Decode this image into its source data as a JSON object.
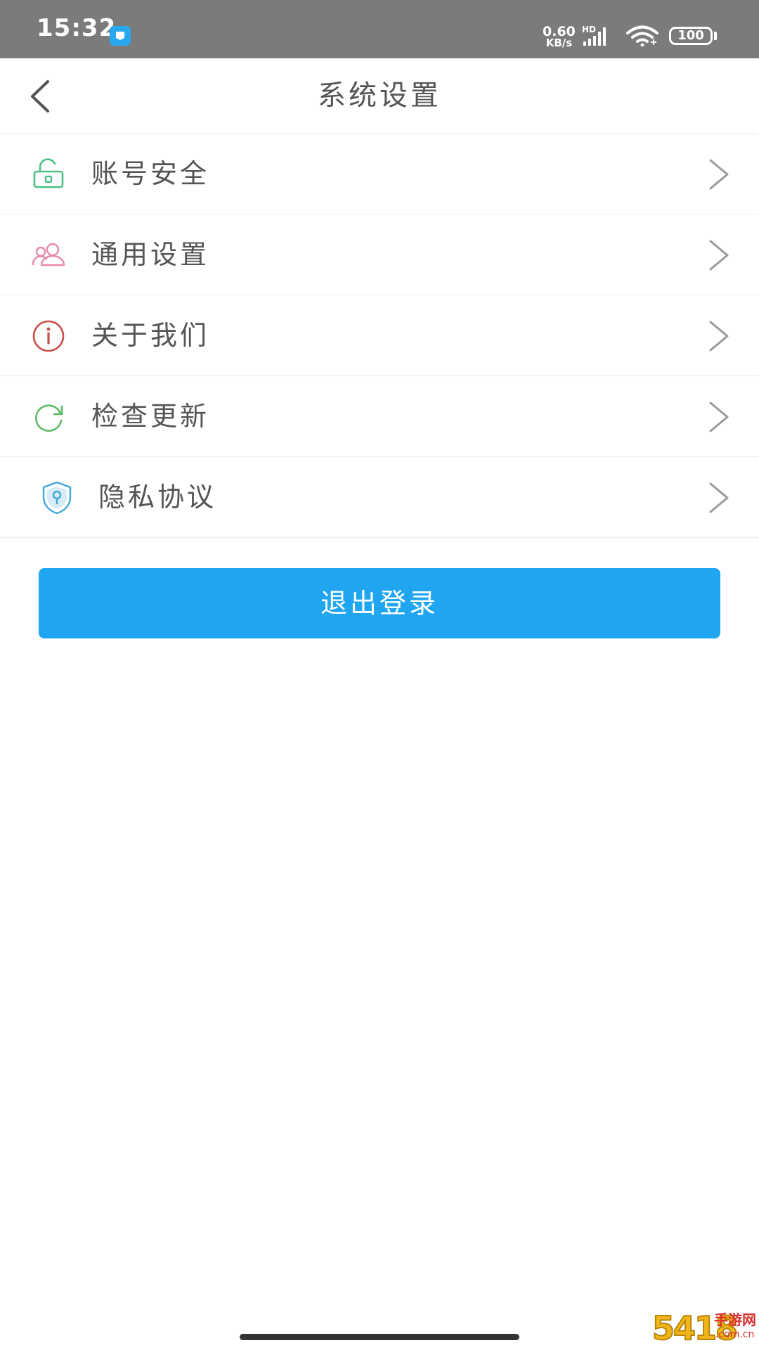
{
  "status_bar": {
    "time": "15:32",
    "net_speed": "0.60",
    "net_unit": "KB/s",
    "network_type": "HD",
    "battery": "100",
    "app_icon": "notification-app-icon",
    "background": "#7b7b7b"
  },
  "header": {
    "title": "系统设置",
    "back_icon": "chevron-left-icon"
  },
  "menu": {
    "items": [
      {
        "label": "账号安全",
        "icon": "unlock-icon",
        "icon_color": "#4cbf83"
      },
      {
        "label": "通用设置",
        "icon": "users-icon",
        "icon_color": "#e88aa6"
      },
      {
        "label": "关于我们",
        "icon": "info-icon",
        "icon_color": "#c9504c"
      },
      {
        "label": "检查更新",
        "icon": "refresh-icon",
        "icon_color": "#5cbb63"
      },
      {
        "label": "隐私协议",
        "icon": "shield-lock-icon",
        "icon_color": "#3fa7d9"
      }
    ],
    "chevron_icon": "chevron-right-icon"
  },
  "logout": {
    "label": "退出登录",
    "color": "#20a6f0"
  },
  "watermark": {
    "digits": "5418",
    "name": "手游网",
    "domain": ".com.cn"
  }
}
